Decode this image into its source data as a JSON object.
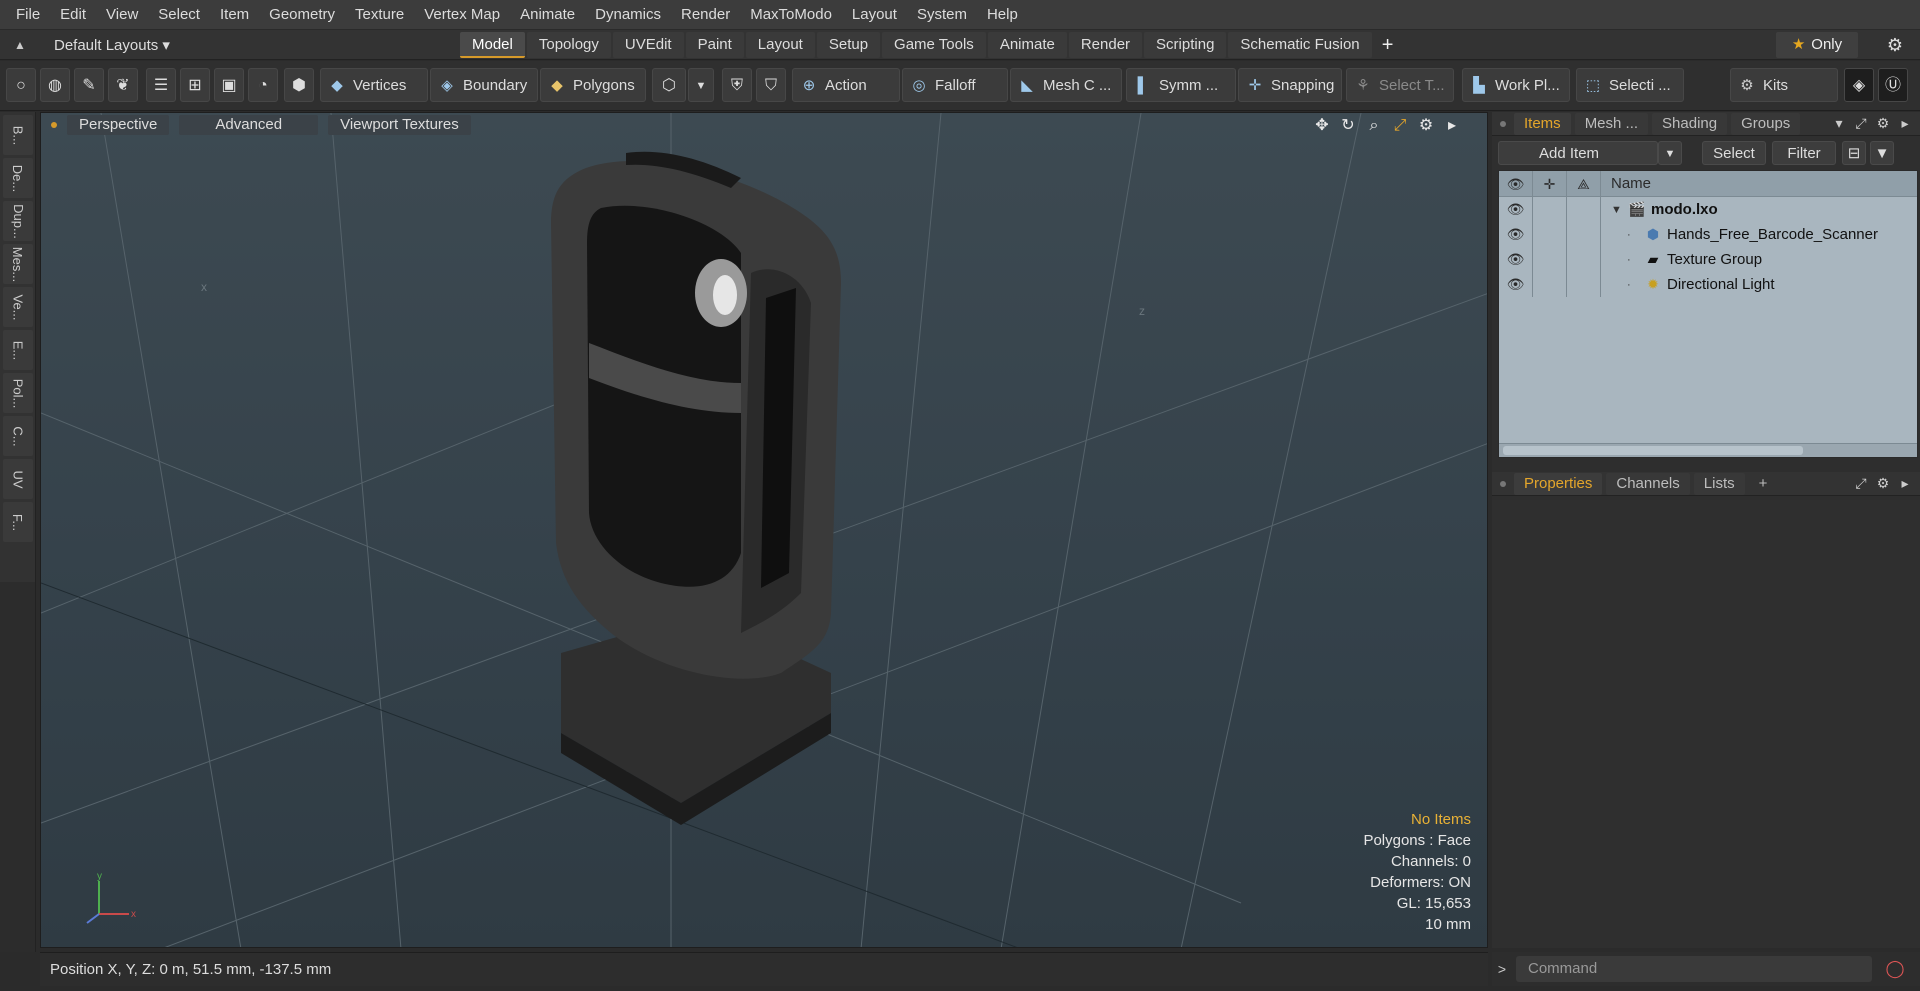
{
  "menu": [
    "File",
    "Edit",
    "View",
    "Select",
    "Item",
    "Geometry",
    "Texture",
    "Vertex Map",
    "Animate",
    "Dynamics",
    "Render",
    "MaxToModo",
    "Layout",
    "System",
    "Help"
  ],
  "layout_select": "Default Layouts ▾",
  "layout_tabs": [
    "Model",
    "Topology",
    "UVEdit",
    "Paint",
    "Layout",
    "Setup",
    "Game Tools",
    "Animate",
    "Render",
    "Scripting",
    "Schematic Fusion"
  ],
  "active_layout_tab": "Model",
  "only_button": "Only",
  "toolbar": {
    "vertices": "Vertices",
    "boundary": "Boundary",
    "polygons": "Polygons",
    "action": "Action",
    "falloff": "Falloff",
    "mesh": "Mesh C ...",
    "symmetry": "Symm ...",
    "snapping": "Snapping",
    "select_tool": "Select T...",
    "work_plane": "Work Pl...",
    "selection": "Selecti ...",
    "kits": "Kits"
  },
  "left_tabs": [
    "B...",
    "De...",
    "Dup...",
    "Mes...",
    "Ve...",
    "E...",
    "Pol...",
    "C...",
    "UV",
    "F..."
  ],
  "viewport": {
    "view_mode": "Perspective",
    "advanced": "Advanced",
    "textures": "Viewport Textures",
    "stats": {
      "items": "No Items",
      "polygons": "Polygons : Face",
      "channels": "Channels: 0",
      "deformers": "Deformers: ON",
      "gl": "GL: 15,653",
      "scale": "10 mm"
    }
  },
  "status_bar": "Position X, Y, Z:   0 m, 51.5 mm, -137.5 mm",
  "items_panel": {
    "tabs": [
      "Items",
      "Mesh ...",
      "Shading",
      "Groups"
    ],
    "active_tab": "Items",
    "add_item": "Add Item",
    "select": "Select",
    "filter": "Filter",
    "name_header": "Name",
    "rows": [
      {
        "name": "modo.lxo",
        "icon": "scene-icon",
        "bold": true
      },
      {
        "name": "Hands_Free_Barcode_Scanner",
        "icon": "mesh-icon"
      },
      {
        "name": "Texture Group",
        "icon": "folder-icon"
      },
      {
        "name": "Directional Light",
        "icon": "light-icon"
      }
    ]
  },
  "properties_panel": {
    "tabs": [
      "Properties",
      "Channels",
      "Lists"
    ],
    "active_tab": "Properties"
  },
  "command_placeholder": "Command",
  "colors": {
    "accent": "#d69a2a",
    "viewport_bg": "#38454d",
    "outliner_bg": "#a9b6bf"
  }
}
